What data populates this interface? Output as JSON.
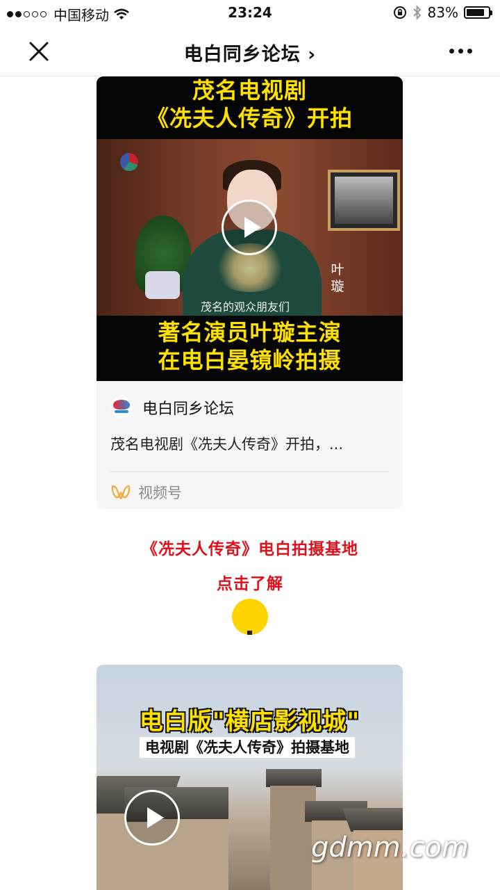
{
  "status_bar": {
    "carrier": "中国移动",
    "time": "23:24",
    "battery": "83%",
    "battery_level": 0.83
  },
  "nav": {
    "title": "电白同乡论坛 ›"
  },
  "card1": {
    "caption_top_1": "茂名电视剧",
    "caption_top_2": "《冼夫人传奇》开拍",
    "side_name": "叶 璇",
    "subtitle": "茂名的观众朋友们",
    "caption_bottom_1": "著名演员叶璇主演",
    "caption_bottom_2": "在电白晏镜岭拍摄",
    "account": "电白同乡论坛",
    "description": "茂名电视剧《冼夫人传奇》开拍，...",
    "channels_label": "视频号"
  },
  "promo": {
    "title": "《冼夫人传奇》电白拍摄基地",
    "link": "点击了解"
  },
  "card2": {
    "title": "电白版\"横店影视城\"",
    "subtitle": "电视剧《冼夫人传奇》拍摄基地"
  },
  "watermark": "gdmm.com",
  "colors": {
    "accent_red": "#e0101a",
    "caption_yellow": "#ffe100",
    "button_yellow": "#ffd200"
  }
}
